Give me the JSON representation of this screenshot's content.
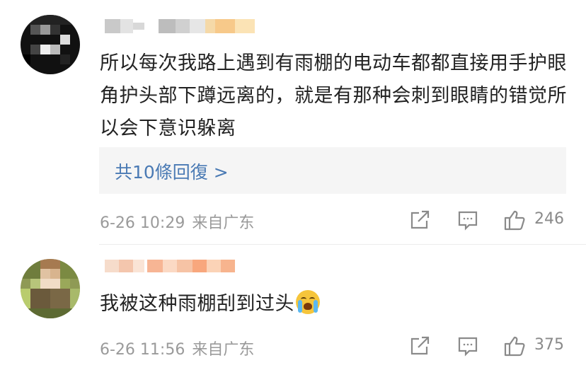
{
  "comments": [
    {
      "text": "所以每次我路上遇到有雨棚的电动车都都直接用手护眼角护头部下蹲远离的，就是有那种会刺到眼睛的错觉所以会下意识躲离",
      "replies_label": "共10條回復 >",
      "time": "6-26 10:29",
      "location": "来自广东",
      "likes": "246"
    },
    {
      "text": "我被这种雨棚刮到过头",
      "emoji": "crying-face-icon",
      "time": "6-26 11:56",
      "location": "来自广东",
      "likes": "375"
    }
  ],
  "colors": {
    "link": "#4a7ab4",
    "meta": "#9a9a9a",
    "reply_bg": "#f5f5f5"
  },
  "icons": [
    "share-icon",
    "comment-icon",
    "like-icon"
  ]
}
